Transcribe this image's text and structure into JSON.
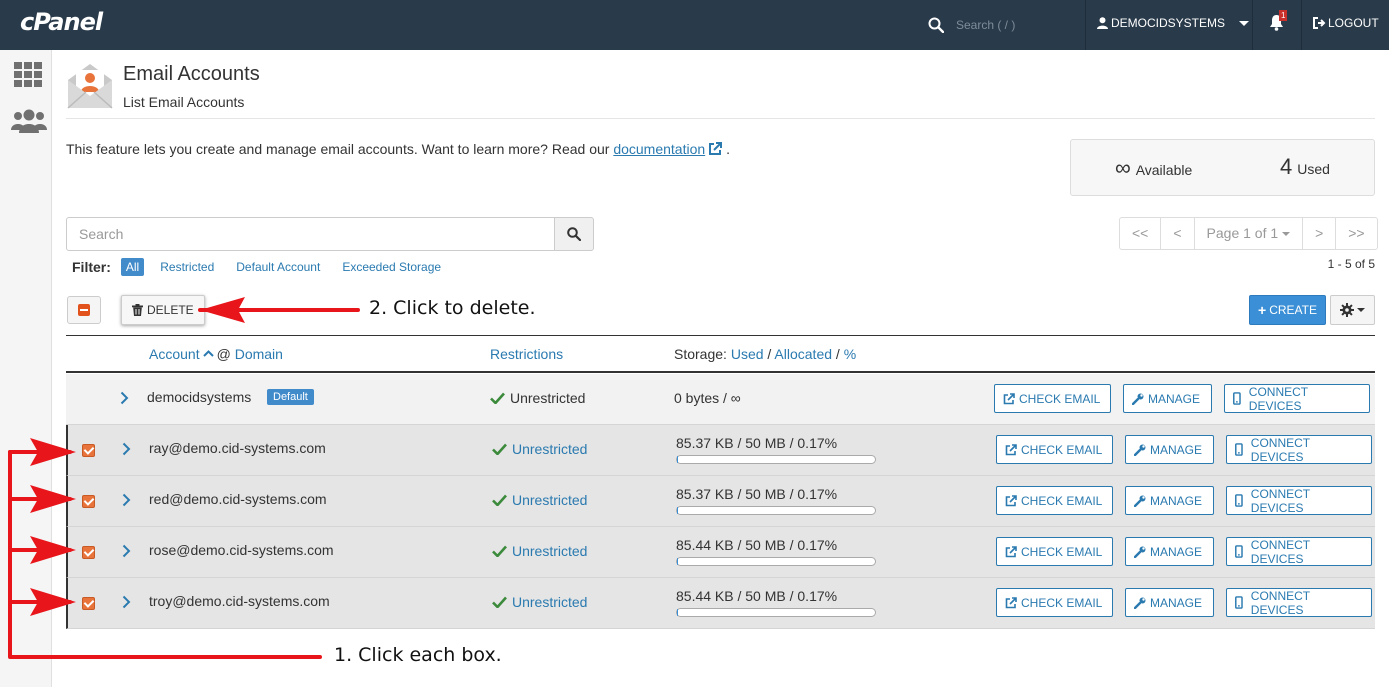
{
  "topbar": {
    "logo": "cPanel",
    "search_placeholder": "Search ( / )",
    "user": "DEMOCIDSYSTEMS",
    "notification_count": "1",
    "logout": "LOGOUT"
  },
  "header": {
    "title": "Email Accounts",
    "subtitle": "List Email Accounts",
    "intro_text": "This feature lets you create and manage email accounts. Want to learn more? Read our ",
    "intro_link": "documentation",
    "intro_end": "."
  },
  "stats": {
    "available_value": "∞",
    "available_label": "Available",
    "used_value": "4",
    "used_label": "Used"
  },
  "search": {
    "placeholder": "Search"
  },
  "pager": {
    "first": "<<",
    "prev": "<",
    "page": "Page 1 of 1",
    "next": ">",
    "last": ">>",
    "range": "1 - 5 of 5"
  },
  "filter": {
    "label": "Filter:",
    "options": [
      "All",
      "Restricted",
      "Default Account",
      "Exceeded Storage"
    ],
    "active": "All"
  },
  "toolbar": {
    "delete": "DELETE",
    "create": "CREATE"
  },
  "table": {
    "headers": {
      "account": "Account",
      "at": "@",
      "domain": "Domain",
      "restrictions": "Restrictions",
      "storage": "Storage:",
      "used": "Used",
      "allocated": "Allocated",
      "percent": "%",
      "sep": "/"
    },
    "rows": [
      {
        "account": "democidsystems",
        "badge": "Default",
        "restriction": "Unrestricted",
        "storage": "0 bytes / ∞",
        "checked": false,
        "usage_percent": 0
      },
      {
        "account": "ray@demo.cid-systems.com",
        "restriction": "Unrestricted",
        "storage": "85.37 KB / 50 MB / 0.17%",
        "checked": true,
        "usage_percent": 0.17
      },
      {
        "account": "red@demo.cid-systems.com",
        "restriction": "Unrestricted",
        "storage": "85.37 KB / 50 MB / 0.17%",
        "checked": true,
        "usage_percent": 0.17
      },
      {
        "account": "rose@demo.cid-systems.com",
        "restriction": "Unrestricted",
        "storage": "85.44 KB / 50 MB / 0.17%",
        "checked": true,
        "usage_percent": 0.17
      },
      {
        "account": "troy@demo.cid-systems.com",
        "restriction": "Unrestricted",
        "storage": "85.44 KB / 50 MB / 0.17%",
        "checked": true,
        "usage_percent": 0.17
      }
    ],
    "actions": {
      "check": "CHECK EMAIL",
      "manage": "MANAGE",
      "connect": "CONNECT DEVICES"
    }
  },
  "annotations": {
    "step1": "1. Click each box.",
    "step2": "2. Click to delete.",
    "color": "#e8161b"
  },
  "colors": {
    "topbar": "#293a4a",
    "link": "#2a7ab0",
    "primary": "#3b8fd6",
    "checkbox": "#e8743c",
    "success": "#3c8a3c"
  }
}
